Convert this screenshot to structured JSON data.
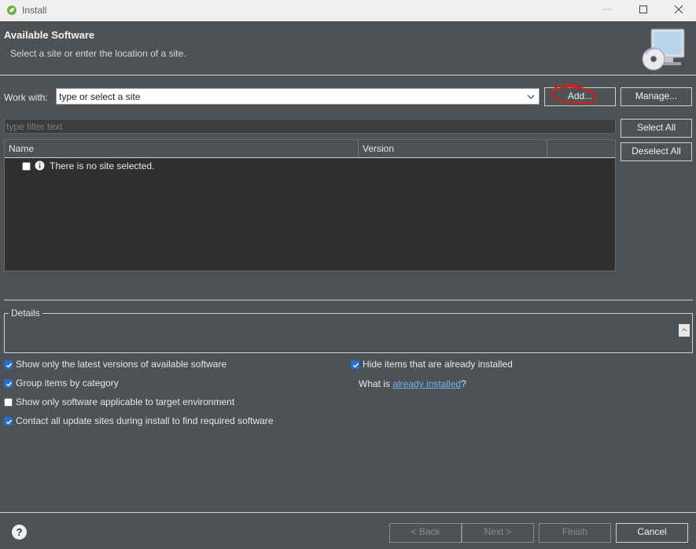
{
  "window": {
    "title": "Install",
    "controls": [
      "minimize",
      "maximize",
      "close"
    ]
  },
  "header": {
    "title": "Available Software",
    "subtitle": "Select a site or enter the location of a site."
  },
  "work_with": {
    "label": "Work with:",
    "combo_value": "type or select a site",
    "add_button": "Add...",
    "manage_button": "Manage..."
  },
  "filter": {
    "placeholder": "type filter text"
  },
  "side_buttons": {
    "select_all": "Select All",
    "deselect_all": "Deselect All"
  },
  "table": {
    "columns": [
      "Name",
      "Version",
      ""
    ],
    "rows": [
      {
        "checked": false,
        "icon": "info-icon",
        "text": "There is no site selected."
      }
    ]
  },
  "details": {
    "legend": "Details"
  },
  "options": {
    "latest_versions": {
      "label": "Show only the latest versions of available software",
      "checked": true
    },
    "group_by_category": {
      "label": "Group items by category",
      "checked": true
    },
    "applicable_only": {
      "label": "Show only software applicable to target environment",
      "checked": false
    },
    "contact_sites": {
      "label": "Contact all update sites during install to find required software",
      "checked": true
    },
    "hide_installed": {
      "label": "Hide items that are already installed",
      "checked": true
    },
    "what_is_prefix": "What is ",
    "what_is_link": "already installed",
    "what_is_suffix": "?"
  },
  "footer": {
    "back": "< Back",
    "next": "Next >",
    "finish": "Finish",
    "cancel": "Cancel"
  },
  "colors": {
    "background": "#4f5254",
    "table_bg": "#2f2f2f",
    "checkbox_checked": "#2a6fc9",
    "link": "#6fb1f2",
    "annotation": "#e01b1b"
  }
}
